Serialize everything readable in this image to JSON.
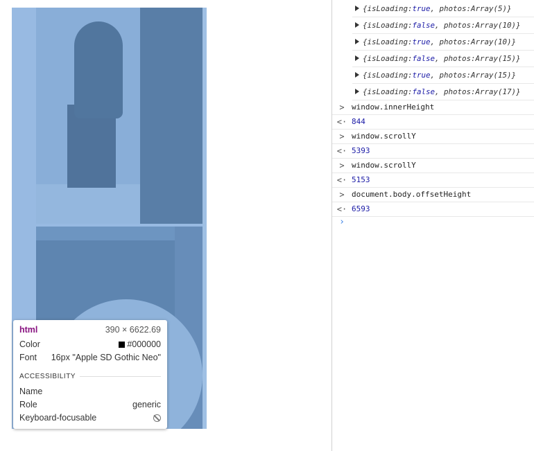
{
  "tooltip": {
    "tag": "html",
    "dimensions": "390 × 6622.69",
    "color_label": "Color",
    "color_value": "#000000",
    "font_label": "Font",
    "font_value": "16px \"Apple SD Gothic Neo\"",
    "accessibility_heading": "ACCESSIBILITY",
    "name_label": "Name",
    "name_value": "",
    "role_label": "Role",
    "role_value": "generic",
    "focusable_label": "Keyboard-focusable",
    "focusable_icon": "no-entry-icon"
  },
  "console": {
    "objects": [
      {
        "isLoading": "true",
        "photos": "Array(5)"
      },
      {
        "isLoading": "false",
        "photos": "Array(10)"
      },
      {
        "isLoading": "true",
        "photos": "Array(10)"
      },
      {
        "isLoading": "false",
        "photos": "Array(15)"
      },
      {
        "isLoading": "true",
        "photos": "Array(15)"
      },
      {
        "isLoading": "false",
        "photos": "Array(17)"
      }
    ],
    "entries": [
      {
        "input": "window.innerHeight",
        "output": "844"
      },
      {
        "input": "window.scrollY",
        "output": "5393"
      },
      {
        "input": "window.scrollY",
        "output": "5153"
      },
      {
        "input": "document.body.offsetHeight",
        "output": "6593"
      }
    ],
    "input_prefix": ">",
    "output_prefix": "<·",
    "prompt_symbol": "›"
  }
}
